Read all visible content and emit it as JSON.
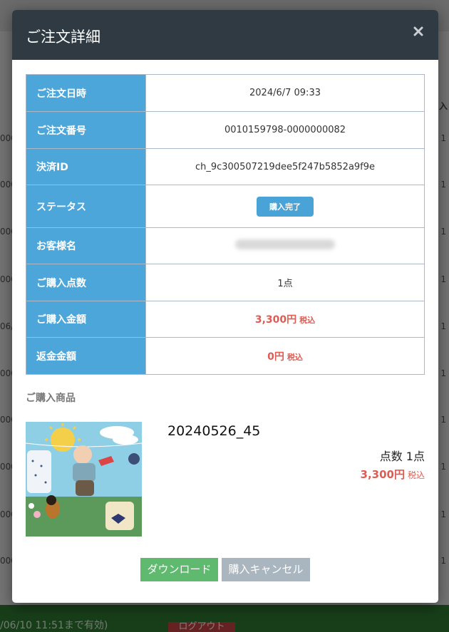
{
  "background": {
    "left_nums": [
      "000",
      "000",
      "000",
      "000",
      "06/",
      "000",
      "000",
      "000",
      "000",
      "000"
    ],
    "right_num": "1",
    "right_header": "入",
    "footer_text": "/06/10 11:51まで有効)",
    "logout_label": "ログアウト"
  },
  "modal": {
    "title": "ご注文詳細",
    "details": [
      {
        "label": "ご注文日時",
        "value": "2024/6/7 09:33"
      },
      {
        "label": "ご注文番号",
        "value": "0010159798-0000000082"
      },
      {
        "label": "決済ID",
        "value": "ch_9c300507219dee5f247b5852a9f9e"
      },
      {
        "label": "ステータス",
        "value": "購入完了"
      },
      {
        "label": "お客様名",
        "value": ""
      },
      {
        "label": "ご購入点数",
        "value": "1点"
      },
      {
        "label": "ご購入金額",
        "value": "3,300円",
        "tax": "税込"
      },
      {
        "label": "返金金額",
        "value": "0円",
        "tax": "税込"
      }
    ],
    "section_label": "ご購入商品",
    "product": {
      "name": "20240526_45",
      "qty": "点数 1点",
      "price": "3,300円",
      "tax": "税込"
    },
    "buttons": {
      "download": "ダウンロード",
      "cancel": "購入キャンセル"
    }
  }
}
